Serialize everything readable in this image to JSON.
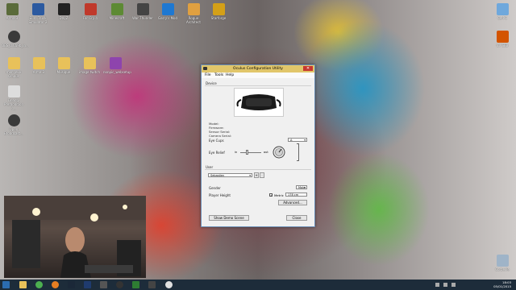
{
  "desktop_icons_top": [
    {
      "label": "Arma 3",
      "color": "#5a6b3a"
    },
    {
      "label": "Euro Truck Simulator 2",
      "color": "#2c5aa0"
    },
    {
      "label": "DayZ",
      "color": "#222222"
    },
    {
      "label": "Far Cry 4",
      "color": "#c0392b"
    },
    {
      "label": "Minecraft",
      "color": "#5d8a34"
    },
    {
      "label": "War Thunder",
      "color": "#444444"
    },
    {
      "label": "Garry's Mod",
      "color": "#1f78d1"
    },
    {
      "label": "Rogue Architect",
      "color": "#e0a040"
    },
    {
      "label": "Starforge",
      "color": "#d4a017"
    }
  ],
  "desktop_icons_left": [
    {
      "label": "OBS_0.659b_In...",
      "color": "#3a3a3a"
    },
    {
      "label": "mon jeux Oculus",
      "color": "#e8c15a"
    },
    {
      "label": "Arma 3",
      "color": "#e8c15a"
    },
    {
      "label": "Musique",
      "color": "#e8c15a"
    },
    {
      "label": "image twitch",
      "color": "#e8c15a"
    },
    {
      "label": "nonpic_websetup",
      "color": "#8e44ad"
    },
    {
      "label": "Deadly Premonition (...",
      "color": "#dddddd"
    },
    {
      "label": "Open Broadcast...",
      "color": "#3a3a3a"
    }
  ],
  "desktop_icons_right": [
    {
      "label": "Ce PC",
      "color": "#6fa8dc"
    },
    {
      "label": "CV SEB",
      "color": "#d35400"
    },
    {
      "label": "Corbeille",
      "color": "#9fb4c8"
    }
  ],
  "dialog": {
    "title": "Oculus Configuration Utility",
    "close_glyph": "✕",
    "menu": [
      "File",
      "Tools",
      "Help"
    ],
    "device_label": "Device",
    "info_lines": [
      "Model:",
      "Firmware:",
      "Sensor Serial:",
      "Camera Serial:"
    ],
    "eye_cups_label": "Eye Cups",
    "eye_cups_value": "A",
    "eye_relief_label": "Eye Relief",
    "eye_relief_in": "in",
    "eye_relief_out": "out",
    "user_label": "User",
    "user_value": "Sebastien",
    "add_user": "+",
    "remove_user": "-",
    "gender_label": "Gender",
    "gender_value": "Male",
    "player_height_label": "Player Height",
    "metric_label": "Metric",
    "height_value": "178 cm",
    "advanced_button": "Advanced...",
    "demo_button": "Show Demo Scene",
    "close_button": "Close"
  },
  "taskbar": {
    "time": "18:03",
    "date": "05/01/2015",
    "apps": [
      "file-explorer",
      "chrome",
      "firefox",
      "steam",
      "photoshop",
      "media",
      "obs",
      "gpu",
      "oculus"
    ]
  }
}
